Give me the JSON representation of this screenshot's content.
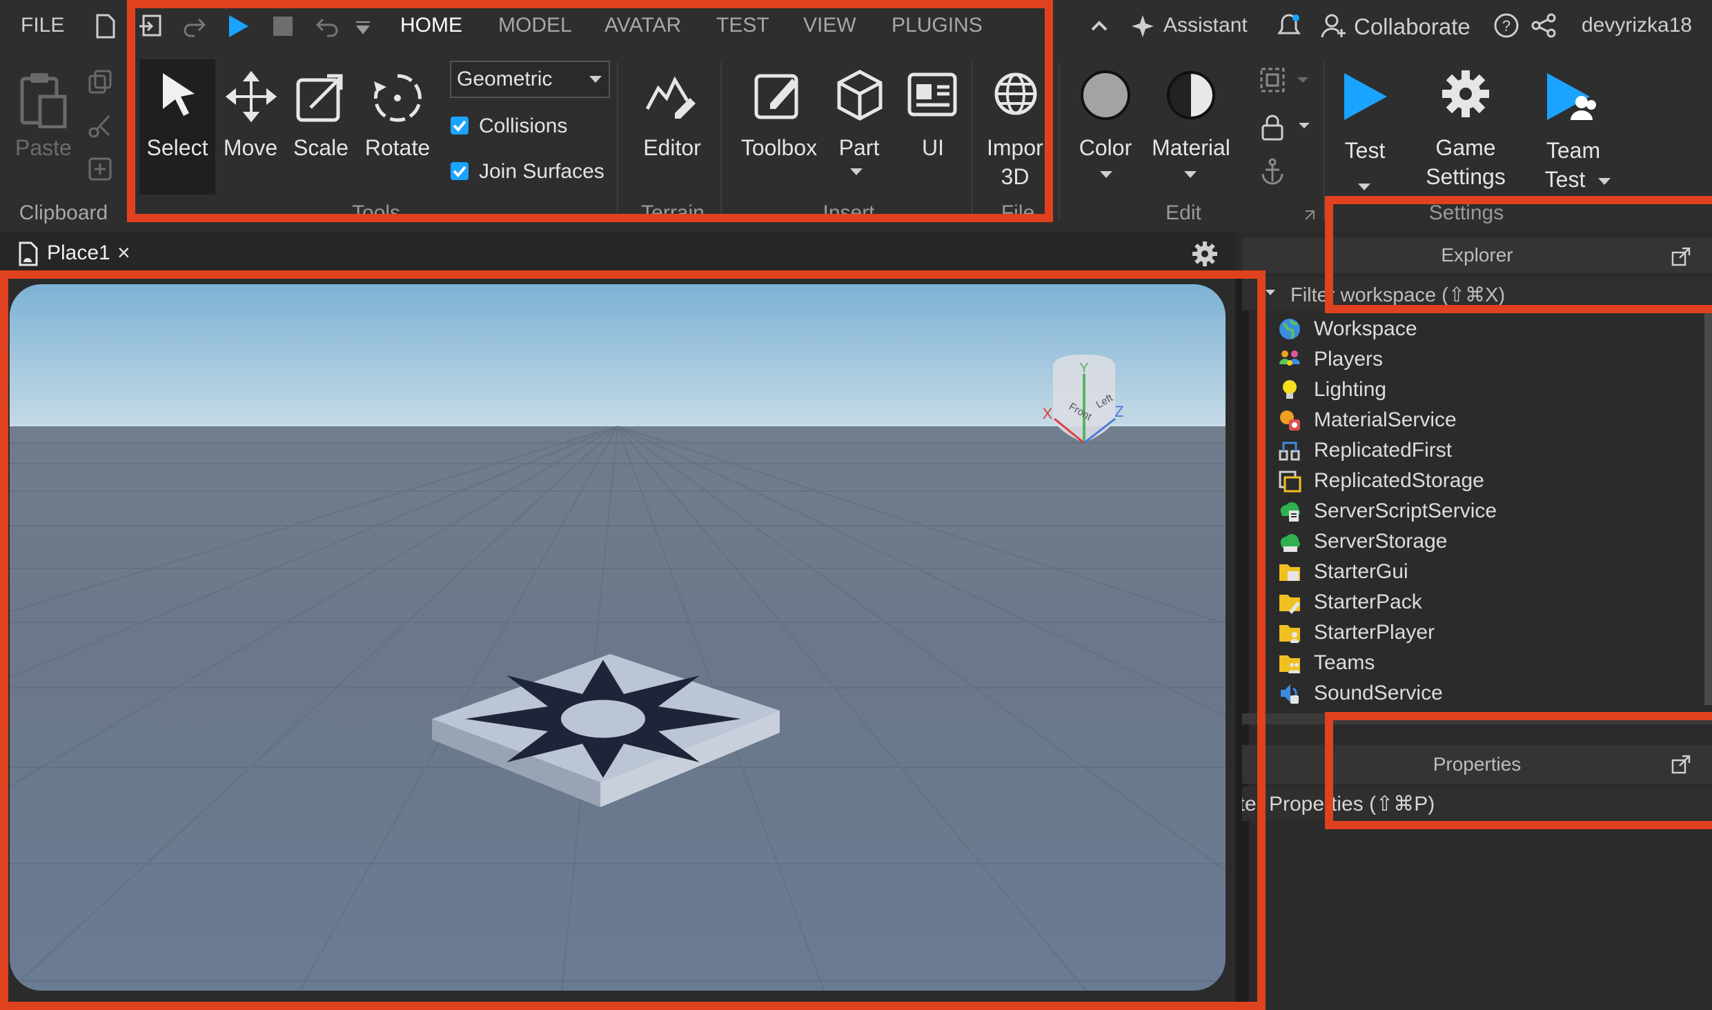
{
  "menu": {
    "file": "FILE",
    "tabs": [
      "HOME",
      "MODEL",
      "AVATAR",
      "TEST",
      "VIEW",
      "PLUGINS"
    ],
    "active_tab": "HOME",
    "assistant": "Assistant",
    "collaborate": "Collaborate",
    "username": "devyrizka18"
  },
  "ribbon": {
    "paste": "Paste",
    "select": "Select",
    "move": "Move",
    "scale": "Scale",
    "rotate": "Rotate",
    "mode_select": "Geometric",
    "collisions": "Collisions",
    "join_surfaces": "Join Surfaces",
    "editor": "Editor",
    "toolbox": "Toolbox",
    "part": "Part",
    "ui": "UI",
    "import_line1": "Impor",
    "import_line2": "3D",
    "color": "Color",
    "material": "Material",
    "test": "Test",
    "game_settings_line1": "Game",
    "game_settings_line2": "Settings",
    "team_test_line1": "Team",
    "team_test_line2": "Test",
    "groups": {
      "clipboard": "Clipboard",
      "tools": "Tools",
      "terrain": "Terrain",
      "insert": "Insert",
      "file": "File",
      "edit": "Edit",
      "settings": "Settings"
    },
    "accent": "#1aa3ff"
  },
  "document_tab": {
    "label": "Place1",
    "close": "×"
  },
  "viewcube": {
    "x": "X",
    "y": "Y",
    "z": "Z",
    "front": "Front",
    "left": "Left"
  },
  "explorer": {
    "title": "Explorer",
    "filter": "Filter workspace (⇧⌘X)",
    "items": [
      {
        "label": "Workspace",
        "icon": "globe-icon"
      },
      {
        "label": "Players",
        "icon": "players-icon"
      },
      {
        "label": "Lighting",
        "icon": "lightbulb-icon"
      },
      {
        "label": "MaterialService",
        "icon": "material-service-icon"
      },
      {
        "label": "ReplicatedFirst",
        "icon": "replicated-first-icon"
      },
      {
        "label": "ReplicatedStorage",
        "icon": "replicated-storage-icon"
      },
      {
        "label": "ServerScriptService",
        "icon": "server-script-service-icon"
      },
      {
        "label": "ServerStorage",
        "icon": "server-storage-icon"
      },
      {
        "label": "StarterGui",
        "icon": "starter-gui-icon"
      },
      {
        "label": "StarterPack",
        "icon": "starter-pack-icon"
      },
      {
        "label": "StarterPlayer",
        "icon": "starter-player-icon"
      },
      {
        "label": "Teams",
        "icon": "teams-icon"
      },
      {
        "label": "SoundService",
        "icon": "sound-service-icon"
      }
    ]
  },
  "properties": {
    "title": "Properties",
    "filter": "Filter Properties (⇧⌘P)"
  },
  "highlight_color": "#e0421f"
}
